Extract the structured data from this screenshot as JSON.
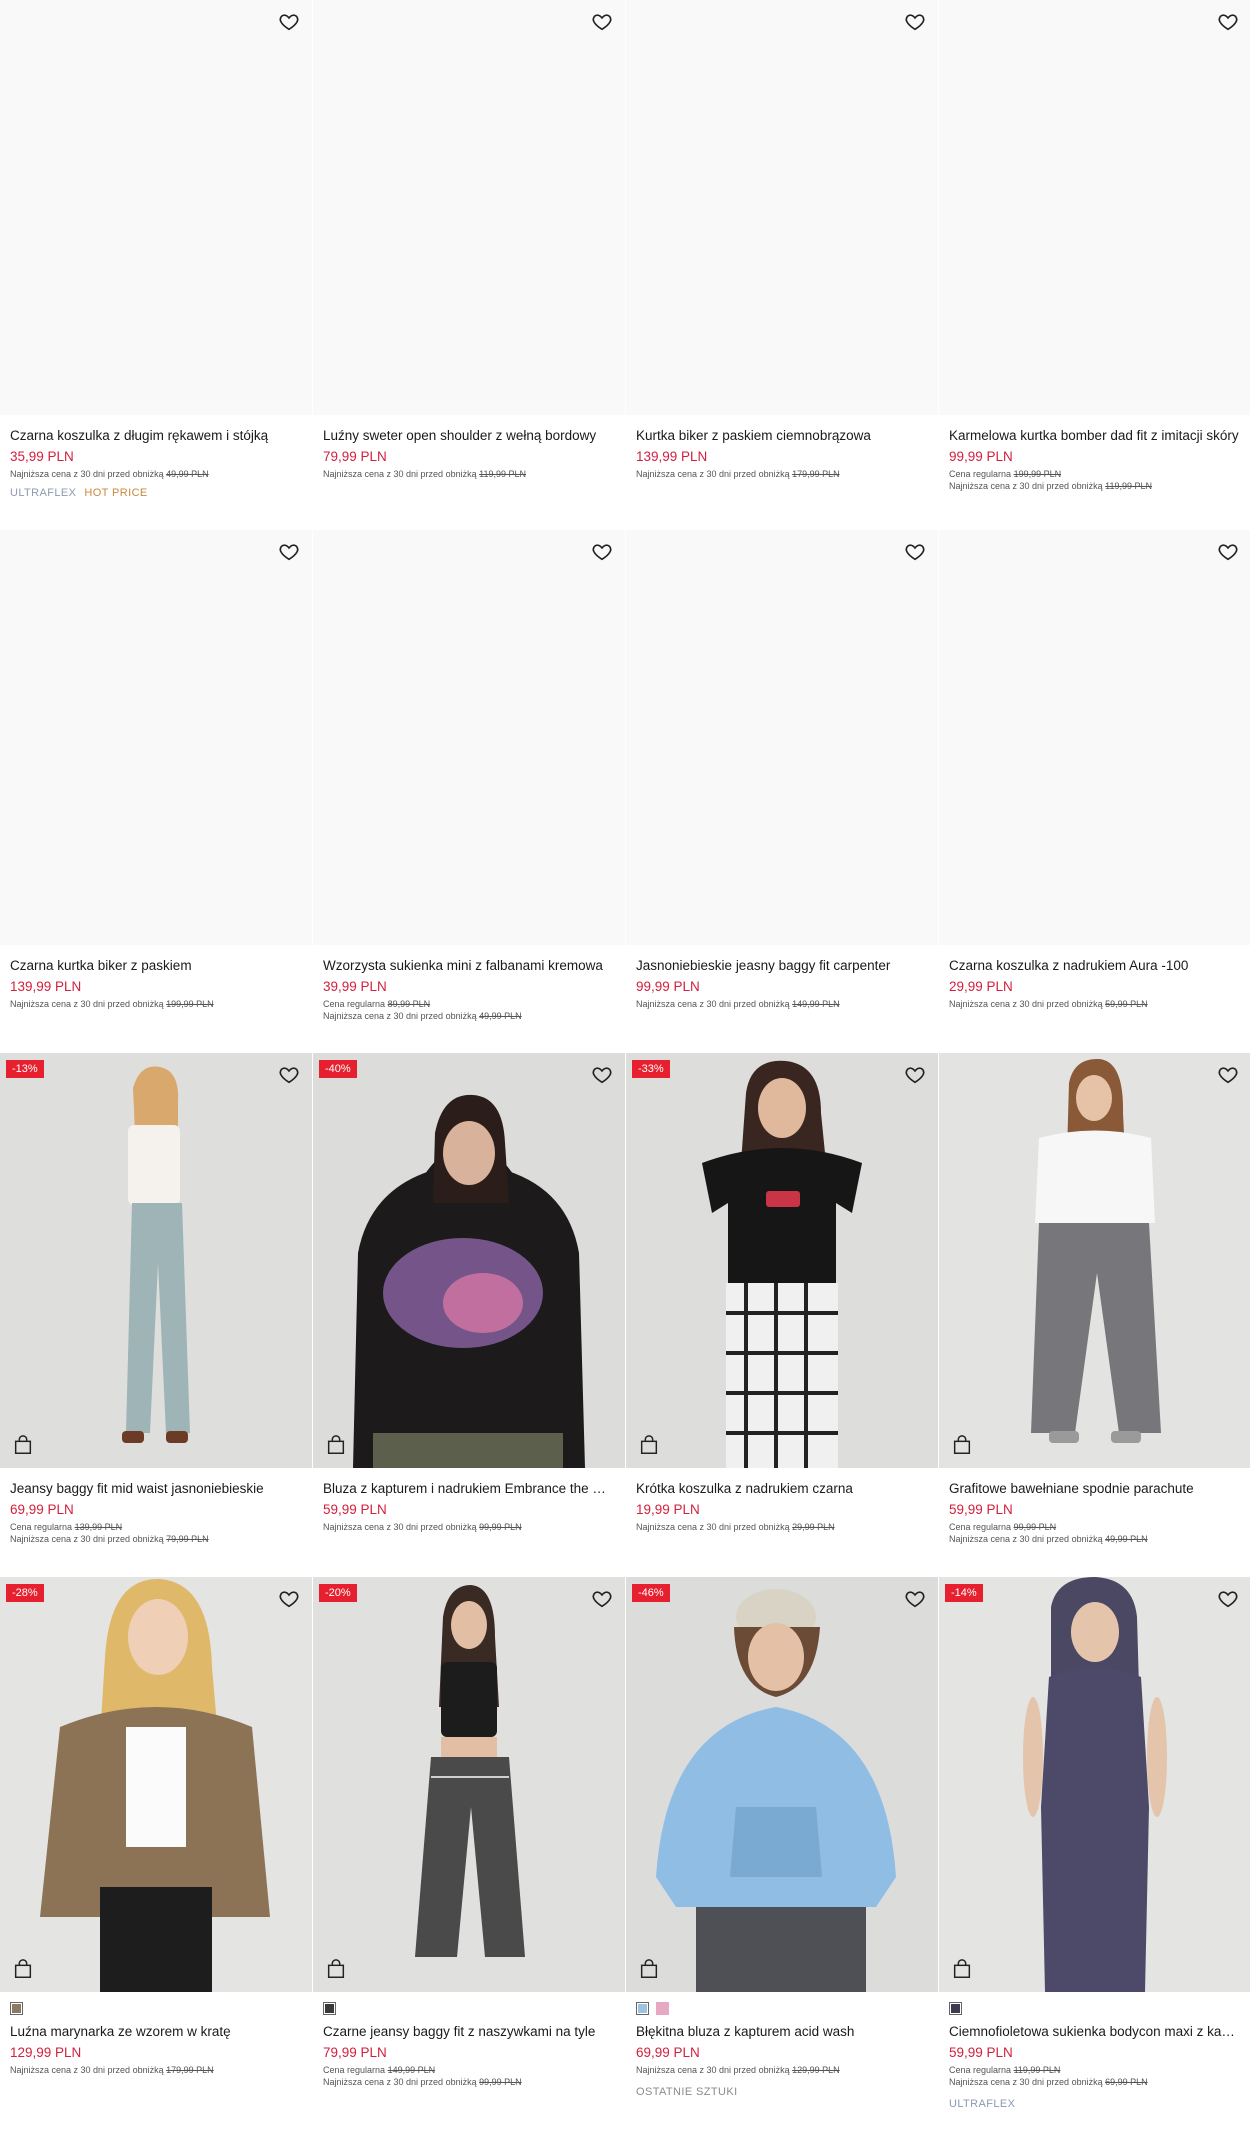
{
  "colors": {
    "price": "#d21f3c",
    "badge": "#e6202e",
    "tag_ultraflex": "#8c9bb0",
    "tag_hot": "#c9893f"
  },
  "rows": [
    {
      "cards": [
        {
          "title": "Czarna koszulka z długim rękawem i stójką",
          "price": "35,99 PLN",
          "regular_label": "",
          "regular_price": "",
          "lowest_label": "Najniższa cena z 30 dni przed obniżką",
          "lowest_price": "49,99 PLN",
          "tag1": "ULTRAFLEX",
          "tag2": "HOT PRICE"
        },
        {
          "title": "Luźny sweter open shoulder z wełną bordowy",
          "price": "79,99 PLN",
          "lowest_label": "Najniższa cena z 30 dni przed obniżką",
          "lowest_price": "119,99 PLN"
        },
        {
          "title": "Kurtka biker z paskiem ciemnobrązowa",
          "price": "139,99 PLN",
          "lowest_label": "Najniższa cena z 30 dni przed obniżką",
          "lowest_price": "179,99 PLN"
        },
        {
          "title": "Karmelowa kurtka bomber dad fit z imitacji skóry",
          "price": "99,99 PLN",
          "regular_label": "Cena regularna",
          "regular_price": "199,99 PLN",
          "lowest_label": "Najniższa cena z 30 dni przed obniżką",
          "lowest_price": "119,99 PLN"
        }
      ]
    },
    {
      "cards": [
        {
          "title": "Czarna kurtka biker z paskiem",
          "price": "139,99 PLN",
          "lowest_label": "Najniższa cena z 30 dni przed obniżką",
          "lowest_price": "199,99 PLN"
        },
        {
          "title": "Wzorzysta sukienka mini z falbanami kremowa",
          "price": "39,99 PLN",
          "regular_label": "Cena regularna",
          "regular_price": "89,99 PLN",
          "lowest_label": "Najniższa cena z 30 dni przed obniżką",
          "lowest_price": "49,99 PLN"
        },
        {
          "title": "Jasnoniebieskie jeasny baggy fit carpenter",
          "price": "99,99 PLN",
          "lowest_label": "Najniższa cena z 30 dni przed obniżką",
          "lowest_price": "149,99 PLN"
        },
        {
          "title": "Czarna koszulka z nadrukiem Aura -100",
          "price": "29,99 PLN",
          "lowest_label": "Najniższa cena z 30 dni przed obniżką",
          "lowest_price": "59,99 PLN"
        }
      ]
    },
    {
      "cards": [
        {
          "badge": "-13%",
          "title": "Jeansy baggy fit mid waist jasnoniebieskie",
          "price": "69,99 PLN",
          "regular_label": "Cena regularna",
          "regular_price": "139,99 PLN",
          "lowest_label": "Najniższa cena z 30 dni przed obniżką",
          "lowest_price": "79,99 PLN"
        },
        {
          "badge": "-40%",
          "title": "Bluza z kapturem i nadrukiem Embrance the Chaos",
          "price": "59,99 PLN",
          "lowest_label": "Najniższa cena z 30 dni przed obniżką",
          "lowest_price": "99,99 PLN"
        },
        {
          "badge": "-33%",
          "title": "Krótka koszulka z nadrukiem czarna",
          "price": "19,99 PLN",
          "lowest_label": "Najniższa cena z 30 dni przed obniżką",
          "lowest_price": "29,99 PLN"
        },
        {
          "title": "Grafitowe bawełniane spodnie parachute",
          "price": "59,99 PLN",
          "regular_label": "Cena regularna",
          "regular_price": "99,99 PLN",
          "lowest_label": "Najniższa cena z 30 dni przed obniżką",
          "lowest_price": "49,99 PLN"
        }
      ]
    },
    {
      "cards": [
        {
          "badge": "-28%",
          "title": "Luźna marynarka ze wzorem w kratę",
          "price": "129,99 PLN",
          "lowest_label": "Najniższa cena z 30 dni przed obniżką",
          "lowest_price": "179,99 PLN",
          "swatches": [
            "#8c7a62"
          ]
        },
        {
          "badge": "-20%",
          "title": "Czarne jeansy baggy fit z naszywkami na tyle",
          "price": "79,99 PLN",
          "regular_label": "Cena regularna",
          "regular_price": "149,99 PLN",
          "lowest_label": "Najniższa cena z 30 dni przed obniżką",
          "lowest_price": "99,99 PLN",
          "swatches": [
            "#3a3a3a"
          ]
        },
        {
          "badge": "-46%",
          "title": "Błękitna bluza z kapturem acid wash",
          "price": "69,99 PLN",
          "lowest_label": "Najniższa cena z 30 dni przed obniżką",
          "lowest_price": "129,99 PLN",
          "tag1": "OSTATNIE SZTUKI",
          "swatches": [
            "#9fc2de",
            "#e7a9c2"
          ]
        },
        {
          "badge": "-14%",
          "title": "Ciemnofioletowa sukienka bodycon maxi z kapturem",
          "price": "59,99 PLN",
          "regular_label": "Cena regularna",
          "regular_price": "119,99 PLN",
          "lowest_label": "Najniższa cena z 30 dni przed obniżką",
          "lowest_price": "69,99 PLN",
          "tag1": "ULTRAFLEX",
          "swatches": [
            "#3e3c50"
          ]
        }
      ]
    }
  ]
}
